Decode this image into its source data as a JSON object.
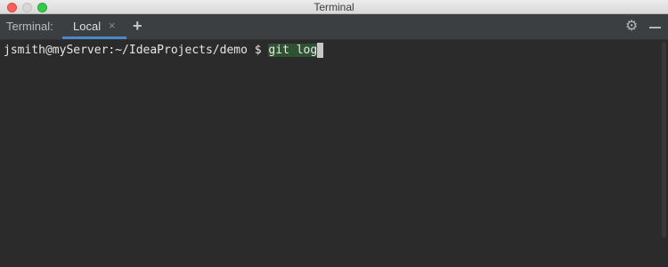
{
  "window": {
    "title": "Terminal"
  },
  "tool_window": {
    "title": "Terminal:",
    "tabs": [
      {
        "label": "Local",
        "close_glyph": "×",
        "active": true
      }
    ],
    "add_tab_glyph": "+",
    "settings_icon": "gear-icon",
    "minimize_icon": "minimize-icon",
    "accent_color": "#4a88c7"
  },
  "terminal": {
    "prompt": "jsmith@myServer:~/IdeaProjects/demo $ ",
    "command": "git log",
    "command_highlight_color": "#2f5332"
  }
}
